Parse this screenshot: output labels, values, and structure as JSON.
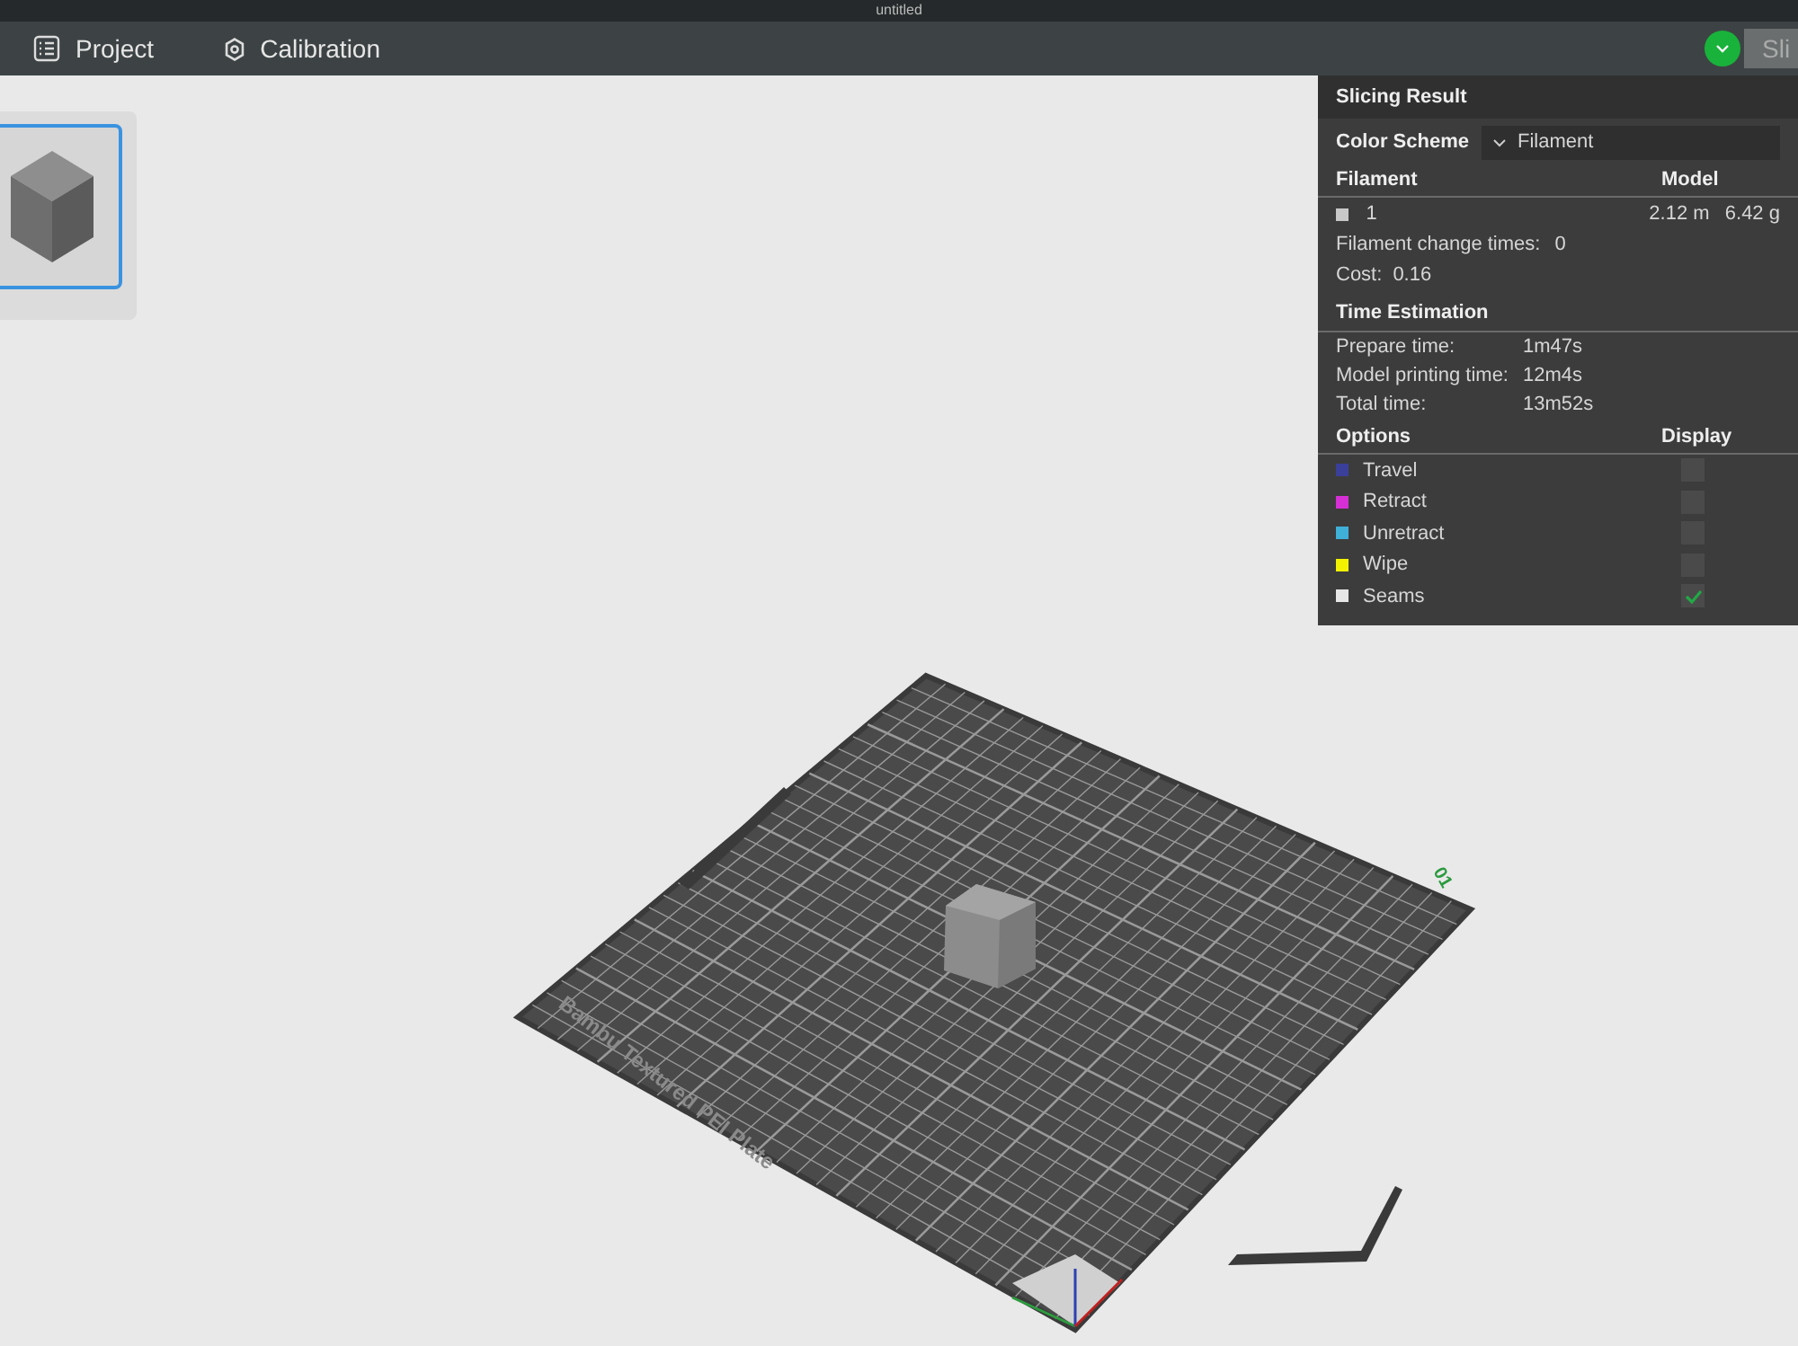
{
  "window": {
    "title": "untitled"
  },
  "toolbar": {
    "tabs": [
      {
        "label": "Project",
        "kind": "list"
      },
      {
        "label": "Calibration",
        "kind": "gear"
      }
    ],
    "slice_button": {
      "label": "Sli"
    }
  },
  "plate_list": [
    {
      "selected": true
    }
  ],
  "plate": {
    "label": "Bambu Textured PEI Plate",
    "number": "01"
  },
  "slicing_result": {
    "title": "Slicing Result",
    "color_scheme": {
      "label": "Color Scheme",
      "value": "Filament"
    },
    "filament_header": {
      "left": "Filament",
      "right": "Model"
    },
    "filaments": [
      {
        "index": "1",
        "color": "#c8c8c8",
        "length": "2.12 m",
        "weight": "6.42 g"
      }
    ],
    "change_times": {
      "label": "Filament change times:",
      "value": "0"
    },
    "cost": {
      "label": "Cost:",
      "value": "0.16"
    },
    "time_title": "Time Estimation",
    "times": [
      {
        "label": "Prepare time:",
        "value": "1m47s"
      },
      {
        "label": "Model printing time:",
        "value": "12m4s"
      },
      {
        "label": "Total time:",
        "value": "13m52s"
      }
    ],
    "options_header": {
      "left": "Options",
      "right": "Display"
    },
    "options": [
      {
        "label": "Travel",
        "color": "#3a3f9a",
        "checked": false
      },
      {
        "label": "Retract",
        "color": "#d62fd6",
        "checked": false
      },
      {
        "label": "Unretract",
        "color": "#3fb0d8",
        "checked": false
      },
      {
        "label": "Wipe",
        "color": "#f2f200",
        "checked": false
      },
      {
        "label": "Seams",
        "color": "#e6e6e6",
        "checked": true
      }
    ]
  }
}
